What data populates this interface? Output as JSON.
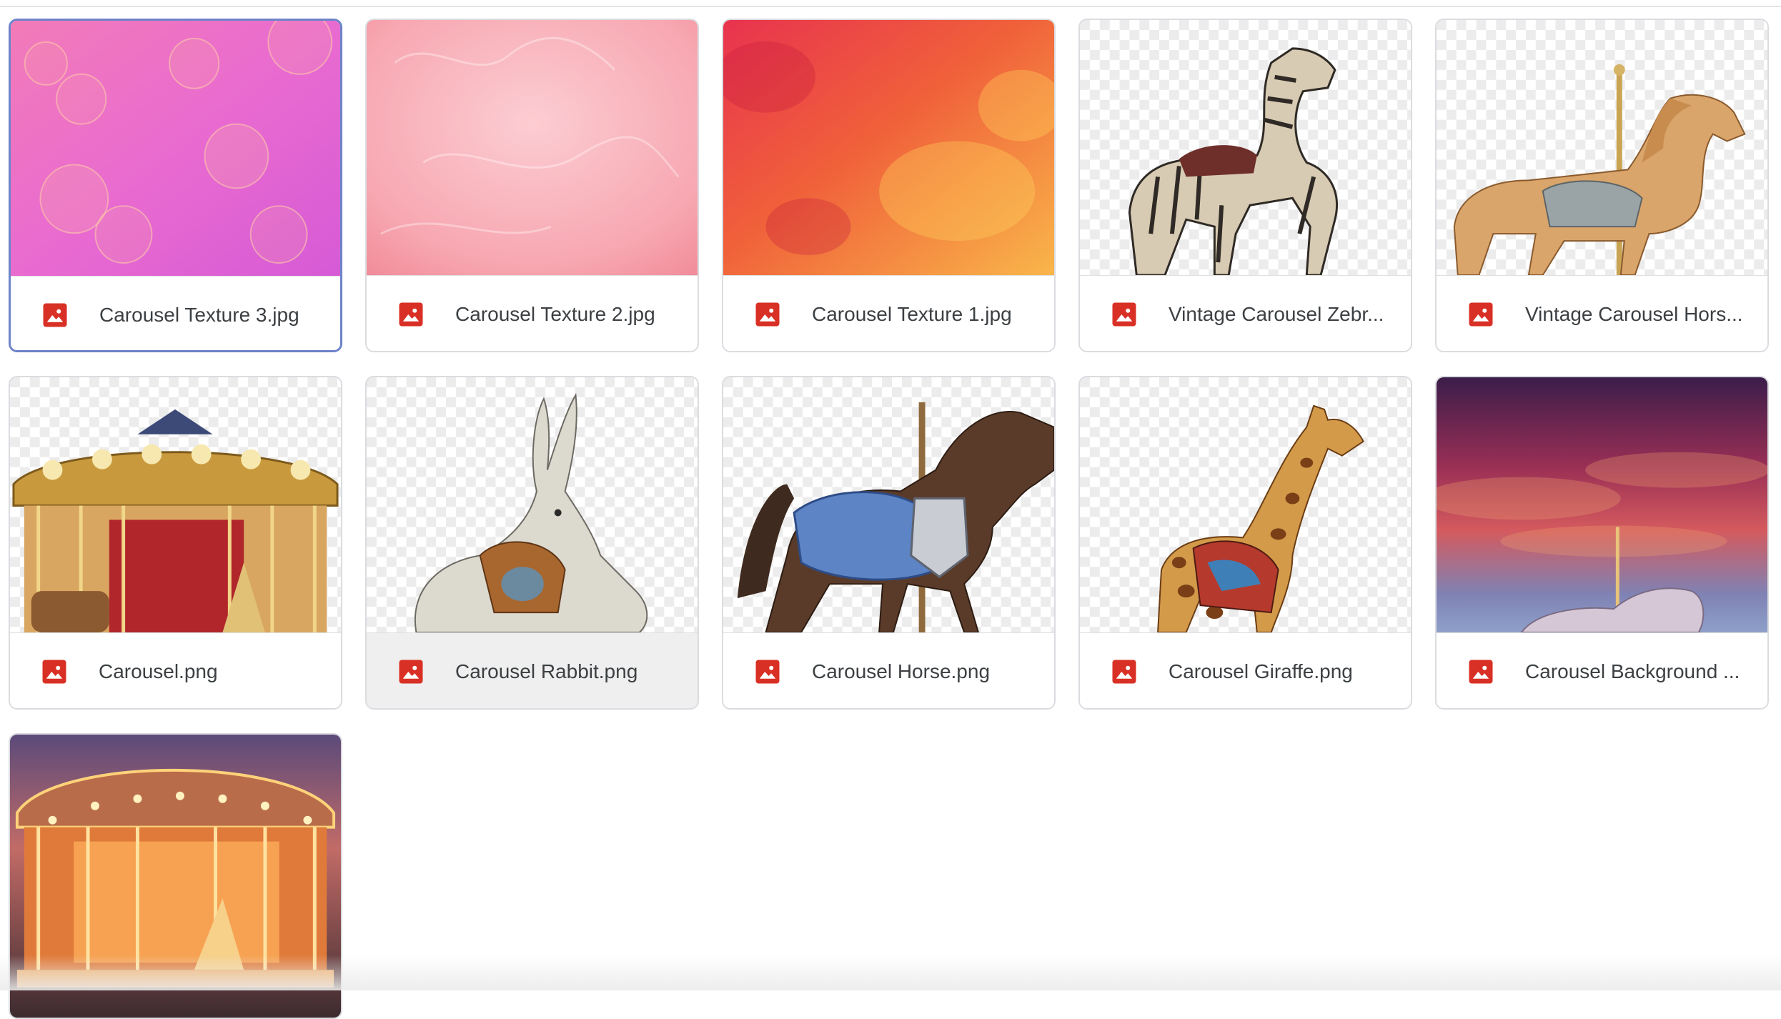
{
  "files": [
    {
      "name": "Carousel Texture 3.jpg",
      "thumbnail": "pink-bokeh-texture",
      "icon": "image-file-icon"
    },
    {
      "name": "Carousel Texture 2.jpg",
      "thumbnail": "pink-watercolor-texture",
      "icon": "image-file-icon"
    },
    {
      "name": "Carousel Texture 1.jpg",
      "thumbnail": "orange-watercolor-texture",
      "icon": "image-file-icon"
    },
    {
      "name": "Vintage Carousel Zebr...",
      "thumbnail": "carousel-zebra",
      "icon": "image-file-icon"
    },
    {
      "name": "Vintage Carousel Hors...",
      "thumbnail": "carousel-horse-vintage",
      "icon": "image-file-icon"
    },
    {
      "name": "Carousel.png",
      "thumbnail": "carousel",
      "icon": "image-file-icon"
    },
    {
      "name": "Carousel Rabbit.png",
      "thumbnail": "carousel-rabbit",
      "icon": "image-file-icon"
    },
    {
      "name": "Carousel Horse.png",
      "thumbnail": "carousel-horse-blue",
      "icon": "image-file-icon"
    },
    {
      "name": "Carousel Giraffe.png",
      "thumbnail": "carousel-giraffe",
      "icon": "image-file-icon"
    },
    {
      "name": "Carousel Background ...",
      "thumbnail": "sunset-sky-background",
      "icon": "image-file-icon"
    },
    {
      "name": "",
      "thumbnail": "lit-carousel-photo",
      "icon": ""
    }
  ],
  "selected_index": 0,
  "hovered_index": 6,
  "colors": {
    "image_icon": "#d93025",
    "card_border": "#dadce0",
    "selected_border": "#6d83c9",
    "text": "#3c4043"
  }
}
